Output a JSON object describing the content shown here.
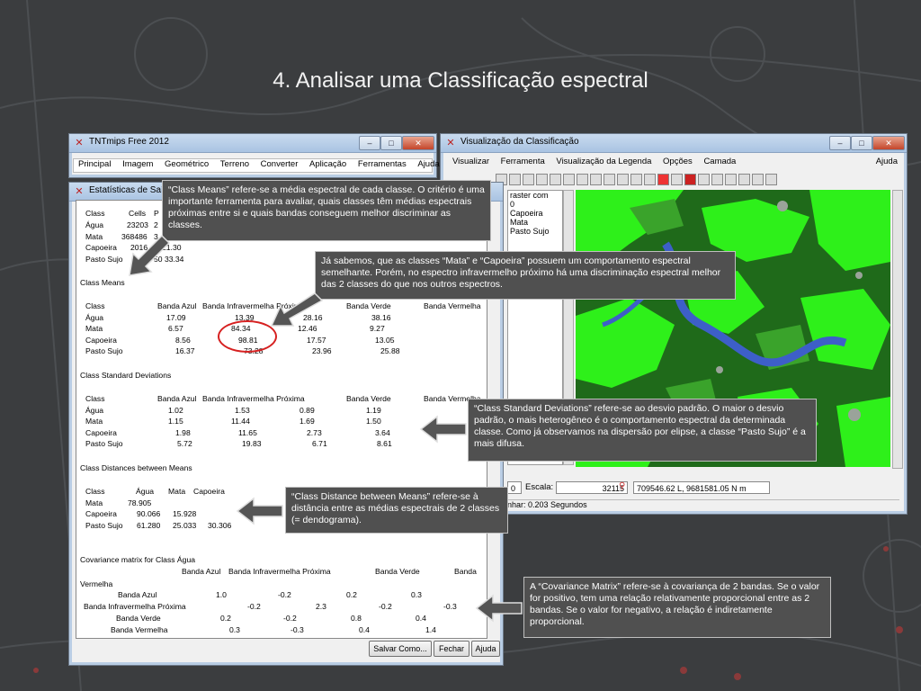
{
  "slide": {
    "title": "4. Analisar uma Classificação espectral"
  },
  "tntmips": {
    "title": "TNTmips Free 2012",
    "menu": [
      "Principal",
      "Imagem",
      "Geométrico",
      "Terreno",
      "Converter",
      "Aplicação",
      "Ferramentas",
      "Ajuda"
    ]
  },
  "stats": {
    "title": "Estatísticas de Saída",
    "summary_header": [
      "Class",
      "Cells",
      "P"
    ],
    "summary_rows": [
      [
        "Água",
        "23203",
        "2"
      ],
      [
        "Mata",
        "368486",
        "3"
      ],
      [
        "Capoeira",
        "2016",
        "21.30"
      ],
      [
        "Pasto Sujo",
        "3",
        "50 33.34"
      ]
    ],
    "means_title": "Class Means",
    "band_headers": [
      "Class",
      "Banda Azul",
      "Banda Infravermelha Próxima",
      "Banda Verde",
      "Banda Vermelha"
    ],
    "means_rows": [
      [
        "Água",
        "17.09",
        "13.39",
        "28.16",
        "38.16"
      ],
      [
        "Mata",
        "6.57",
        "84.34",
        "12.46",
        "9.27"
      ],
      [
        "Capoeira",
        "8.56",
        "98.81",
        "17.57",
        "13.05"
      ],
      [
        "Pasto Sujo",
        "16.37",
        "73.28",
        "23.96",
        "25.88"
      ]
    ],
    "std_title": "Class Standard Deviations",
    "std_rows": [
      [
        "Água",
        "1.02",
        "1.53",
        "0.89",
        "1.19"
      ],
      [
        "Mata",
        "1.15",
        "11.44",
        "1.69",
        "1.50"
      ],
      [
        "Capoeira",
        "1.98",
        "11.65",
        "2.73",
        "3.64"
      ],
      [
        "Pasto Sujo",
        "5.72",
        "19.83",
        "6.71",
        "8.61"
      ]
    ],
    "dist_title": "Class Distances between Means",
    "dist_header": [
      "Class",
      "Água",
      "Mata",
      "Capoeira"
    ],
    "dist_rows": [
      [
        "Mata",
        "78.905",
        "",
        ""
      ],
      [
        "Capoeira",
        "90.066",
        "15.928",
        ""
      ],
      [
        "Pasto Sujo",
        "61.280",
        "25.033",
        "30.306"
      ]
    ],
    "cov_title": "Covariance matrix for Class Água",
    "cov_header": [
      "Banda Azul",
      "Banda Infravermelha Próxima",
      "Banda Verde",
      "Banda"
    ],
    "cov_header2": "Vermelha",
    "cov_rows": [
      [
        "Banda Azul",
        "1.0",
        "-0.2",
        "0.2",
        "0.3"
      ],
      [
        "Banda Infravermelha Próxima",
        "-0.2",
        "2.3",
        "-0.2",
        "-0.3"
      ],
      [
        "Banda Verde",
        "0.2",
        "-0.2",
        "0.8",
        "0.4"
      ],
      [
        "Banda Vermelha",
        "0.3",
        "-0.3",
        "0.4",
        "1.4"
      ]
    ],
    "buttons": {
      "save": "Salvar Como...",
      "close": "Fechar",
      "help": "Ajuda"
    }
  },
  "classview": {
    "title": "Visualização da Classificação",
    "menu": [
      "Visualizar",
      "Ferramenta",
      "Visualização da Legenda",
      "Opções",
      "Camada"
    ],
    "menu_help": "Ajuda",
    "legend": [
      "raster com",
      "0",
      "Capoeira",
      "Mata",
      "Pasto Sujo"
    ],
    "scale_label": "Escala:",
    "scale_value": "32115",
    "coords": "709546.62 L, 9681581.05 N m",
    "zoom_field": "0",
    "render_time": "nhar: 0.203 Segundos"
  },
  "callouts": {
    "means": "“Class Means” refere-se a média espectral de cada classe. O critério é uma importante ferramenta para avaliar, quais classes têm médias espectrais próximas entre si e quais bandas conseguem melhor discriminar as classes.",
    "mata_capoeira": "Já sabemos, que as classes “Mata” e “Capoeira” possuem um comportamento espectral semelhante. Porém, no espectro infravermelho próximo há uma discriminação espectral melhor das 2 classes do que nos outros espectros.",
    "std": "“Class Standard Deviations” refere-se ao desvio padrão. O maior o desvio padrão, o mais heterogêneo é o comportamento espectral da determinada classe. Como já observamos na dispersão por elipse, a classe “Pasto Sujo” é a mais difusa.",
    "dist": "“Class Distance between Means” refere-se à distância entre as médias espectrais de 2 classes (= dendograma).",
    "cov": "A “Covariance Matrix” refere-se à covariança de 2 bandas. Se o valor for positivo, tem uma relação relativamente proporcional entre as 2 bandas. Se o valor for negativo, a relação é indiretamente proporcional."
  },
  "colors": {
    "callout_bg": "#505050",
    "highlight_circle": "#d62020",
    "map_dark": "#1f6a1a",
    "map_bright": "#2ef01a",
    "river": "#3d5fc8"
  }
}
